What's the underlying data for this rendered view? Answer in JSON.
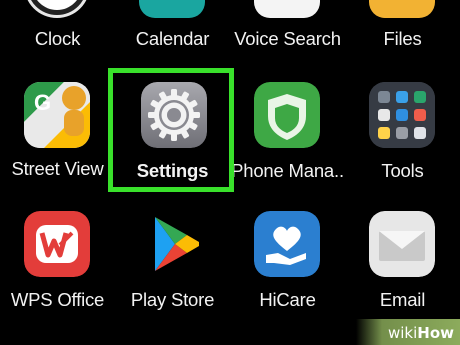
{
  "apps": [
    {
      "label": "Clock",
      "icon": "clock-icon"
    },
    {
      "label": "Calendar",
      "icon": "calendar-icon"
    },
    {
      "label": "Voice Search",
      "icon": "voice-search-icon"
    },
    {
      "label": "Files",
      "icon": "files-icon"
    },
    {
      "label": "Street View",
      "icon": "street-view-icon"
    },
    {
      "label": "Settings",
      "icon": "gear-icon",
      "highlighted": true
    },
    {
      "label": "Phone Mana..",
      "icon": "phone-manager-icon"
    },
    {
      "label": "Tools",
      "icon": "tools-folder-icon"
    },
    {
      "label": "WPS Office",
      "icon": "wps-office-icon"
    },
    {
      "label": "Play Store",
      "icon": "play-store-icon"
    },
    {
      "label": "HiCare",
      "icon": "hicare-icon"
    },
    {
      "label": "Email",
      "icon": "email-icon"
    }
  ],
  "watermark": {
    "part1": "wiki",
    "part2": "How"
  },
  "colors": {
    "highlight": "#39e12b",
    "background": "#000000",
    "watermark_bg": "#8cab5c"
  }
}
